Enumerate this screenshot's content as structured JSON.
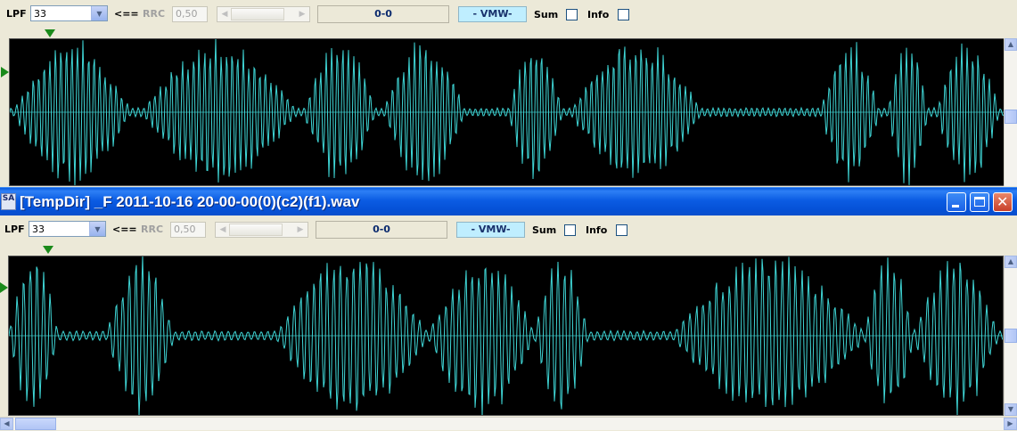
{
  "panels": [
    {
      "lpf_label": "LPF",
      "lpf_value": "33",
      "arrow_label": "<==",
      "rrc_label": "RRC",
      "rrc_value": "0,50",
      "counter": "0-0",
      "mode_badge": "- VMW-",
      "sum_label": "Sum",
      "info_label": "Info"
    },
    {
      "lpf_label": "LPF",
      "lpf_value": "33",
      "arrow_label": "<==",
      "rrc_label": "RRC",
      "rrc_value": "0,50",
      "counter": "0-0",
      "mode_badge": "- VMW-",
      "sum_label": "Sum",
      "info_label": "Info"
    }
  ],
  "window": {
    "title": "[TempDir] _F  2011-10-16 20-00-00(0)(c2)(f1).wav",
    "icon_text": "SA",
    "buttons": [
      "minimize-icon",
      "maximize-icon",
      "close-icon"
    ]
  },
  "colors": {
    "waveform": "#3fd6d6",
    "waveform_bg": "#000000",
    "titlebar": "#0b5ce3",
    "marker": "#1a8a1a"
  }
}
